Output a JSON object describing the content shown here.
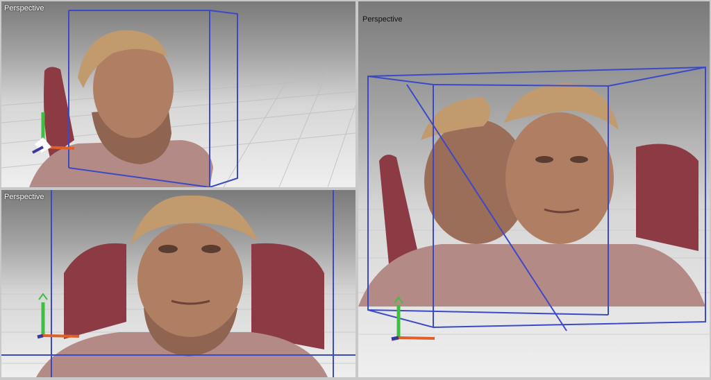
{
  "viewports": {
    "top_left": {
      "label": "Perspective"
    },
    "bottom_left": {
      "label": "Perspective"
    },
    "right": {
      "label": "Perspective"
    }
  },
  "colors": {
    "bounding_box": "#3b49c8",
    "skin": "#b07f63",
    "hair": "#c19a6e",
    "shirt": "#b48a86",
    "chair": "#8c3a44",
    "axis_y": "#3fbf3f",
    "axis_x": "#e0602a",
    "axis_z": "#3a3a9a"
  },
  "icons": [
    "axis-gizmo-icon"
  ]
}
